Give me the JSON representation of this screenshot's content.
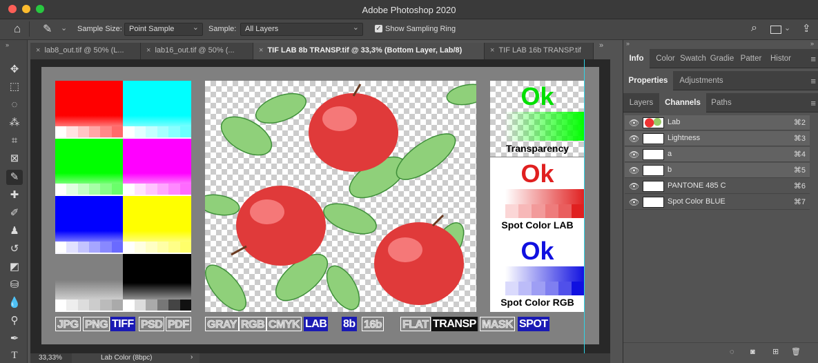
{
  "app_title": "Adobe Photoshop 2020",
  "options": {
    "sample_size_label": "Sample Size:",
    "sample_size_value": "Point Sample",
    "sample_label": "Sample:",
    "sample_value": "All Layers",
    "show_sampling_ring": "Show Sampling Ring"
  },
  "tabs": [
    {
      "label": "lab8_out.tif @ 50% (L..."
    },
    {
      "label": "lab16_out.tif @ 50% (..."
    },
    {
      "label": "TIF LAB 8b TRANSP.tif @ 33,3% (Bottom Layer, Lab/8)"
    },
    {
      "label": "TIF LAB 16b TRANSP.tif"
    }
  ],
  "canvas": {
    "ok1": "Ok",
    "ok1_caption": "Transparency",
    "ok2": "Ok",
    "ok2_caption": "Spot Color LAB",
    "ok3": "Ok",
    "ok3_caption": "Spot Color RGB",
    "format_labels": [
      "JPG",
      "PNG",
      "TIFF",
      "PSD",
      "PDF"
    ],
    "mode_labels": [
      "GRAY",
      "RGB",
      "CMYK",
      "LAB"
    ],
    "depth_labels": [
      "8b",
      "16b"
    ],
    "feature_labels": [
      "FLAT",
      "TRANSP",
      "MASK",
      "SPOT"
    ]
  },
  "status": {
    "zoom": "33,33%",
    "info": "Lab Color (8bpc)"
  },
  "panel": {
    "top_tabs": [
      "Info",
      "Color",
      "Swatch",
      "Gradie",
      "Patter",
      "Histor"
    ],
    "mid_tabs": [
      "Properties",
      "Adjustments"
    ],
    "low_tabs": [
      "Layers",
      "Channels",
      "Paths"
    ],
    "channels": [
      {
        "name": "Lab",
        "shortcut": "⌘2"
      },
      {
        "name": "Lightness",
        "shortcut": "⌘3"
      },
      {
        "name": "a",
        "shortcut": "⌘4"
      },
      {
        "name": "b",
        "shortcut": "⌘5"
      },
      {
        "name": "PANTONE 485 C",
        "shortcut": "⌘6"
      },
      {
        "name": "Spot Color BLUE",
        "shortcut": "⌘7"
      }
    ]
  },
  "colors": {
    "red": "#ff0000",
    "cyan": "#00ffff",
    "green": "#00ff00",
    "magenta": "#ff00ff",
    "blue": "#0000ff",
    "yellow": "#ffff00",
    "spot_blue": "#1a1ab4"
  }
}
